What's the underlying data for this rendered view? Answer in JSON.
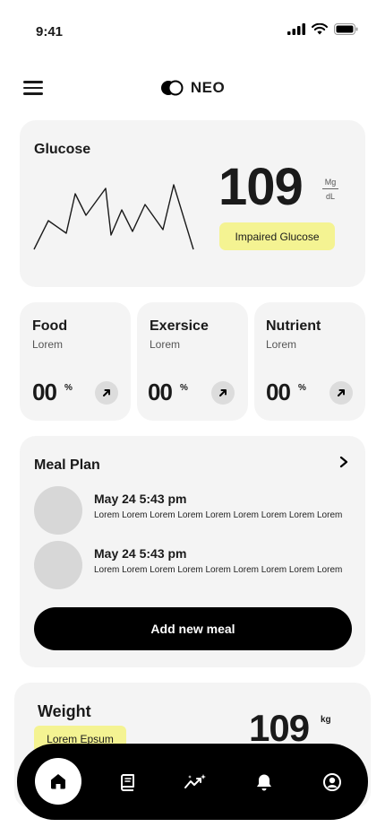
{
  "status_bar": {
    "time": "9:41"
  },
  "header": {
    "brand": "NEO",
    "logo_icon": "neo-logo-icon",
    "menu_icon": "hamburger-menu-icon"
  },
  "glucose": {
    "title": "Glucose",
    "value": "109",
    "unit_top": "Mg",
    "unit_bottom": "dL",
    "badge": "Impaired Glucose",
    "badge_color": "#f4f392"
  },
  "metrics": [
    {
      "title": "Food",
      "subtitle": "Lorem",
      "value": "00",
      "unit": "%"
    },
    {
      "title": "Exersice",
      "subtitle": "Lorem",
      "value": "00",
      "unit": "%"
    },
    {
      "title": "Nutrient",
      "subtitle": "Lorem",
      "value": "00",
      "unit": "%"
    }
  ],
  "meal_plan": {
    "title": "Meal Plan",
    "items": [
      {
        "date": "May 24  5:43 pm",
        "description": "Lorem Lorem Lorem Lorem Lorem Lorem Lorem Lorem Lorem"
      },
      {
        "date": "May 24  5:43 pm",
        "description": "Lorem Lorem Lorem Lorem Lorem Lorem Lorem Lorem Lorem"
      }
    ],
    "add_button": "Add new meal"
  },
  "weight": {
    "title": "Weight",
    "badge": "Lorem Epsum",
    "value": "109",
    "unit": "kg"
  },
  "nav": {
    "items": [
      "home-icon",
      "book-icon",
      "trend-sparkle-icon",
      "bell-icon",
      "profile-icon"
    ],
    "active": "home-icon"
  },
  "colors": {
    "accent_yellow": "#f4f392",
    "card_bg": "#f4f4f4",
    "nav_bg": "#000000"
  }
}
